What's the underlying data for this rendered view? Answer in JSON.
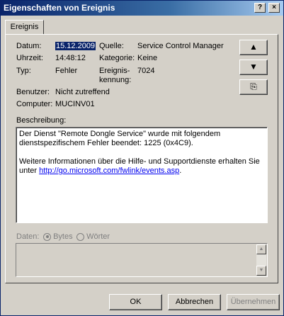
{
  "window": {
    "title": "Eigenschaften von Ereignis",
    "help": "?",
    "close": "×"
  },
  "tab": {
    "label": "Ereignis"
  },
  "fields": {
    "datum_label": "Datum:",
    "datum_value": "15.12.2009",
    "uhrzeit_label": "Uhrzeit:",
    "uhrzeit_value": "14:48:12",
    "typ_label": "Typ:",
    "typ_value": "Fehler",
    "benutzer_label": "Benutzer:",
    "benutzer_value": "Nicht zutreffend",
    "computer_label": "Computer:",
    "computer_value": "MUCINV01",
    "quelle_label": "Quelle:",
    "quelle_value": "Service Control Manager",
    "kategorie_label": "Kategorie:",
    "kategorie_value": "Keine",
    "kennung_label_1": "Ereignis-",
    "kennung_label_2": "kennung:",
    "kennung_value": "7024"
  },
  "nav": {
    "up": "▲",
    "down": "▼",
    "copy": "⎘"
  },
  "beschreibung": {
    "label": "Beschreibung:",
    "line1": "Der Dienst \"Remote Dongle Service\" wurde mit folgendem",
    "line2": "dienstspezifischem Fehler beendet: 1225 (0x4C9).",
    "line3": "Weitere Informationen über die Hilfe- und Supportdienste erhalten Sie",
    "line4_prefix": "unter ",
    "link": "http://go.microsoft.com/fwlink/events.asp",
    "line4_suffix": "."
  },
  "daten": {
    "label": "Daten:",
    "bytes": "Bytes",
    "woerter": "Wörter"
  },
  "buttons": {
    "ok": "OK",
    "abbrechen": "Abbrechen",
    "uebernehmen": "Übernehmen"
  }
}
